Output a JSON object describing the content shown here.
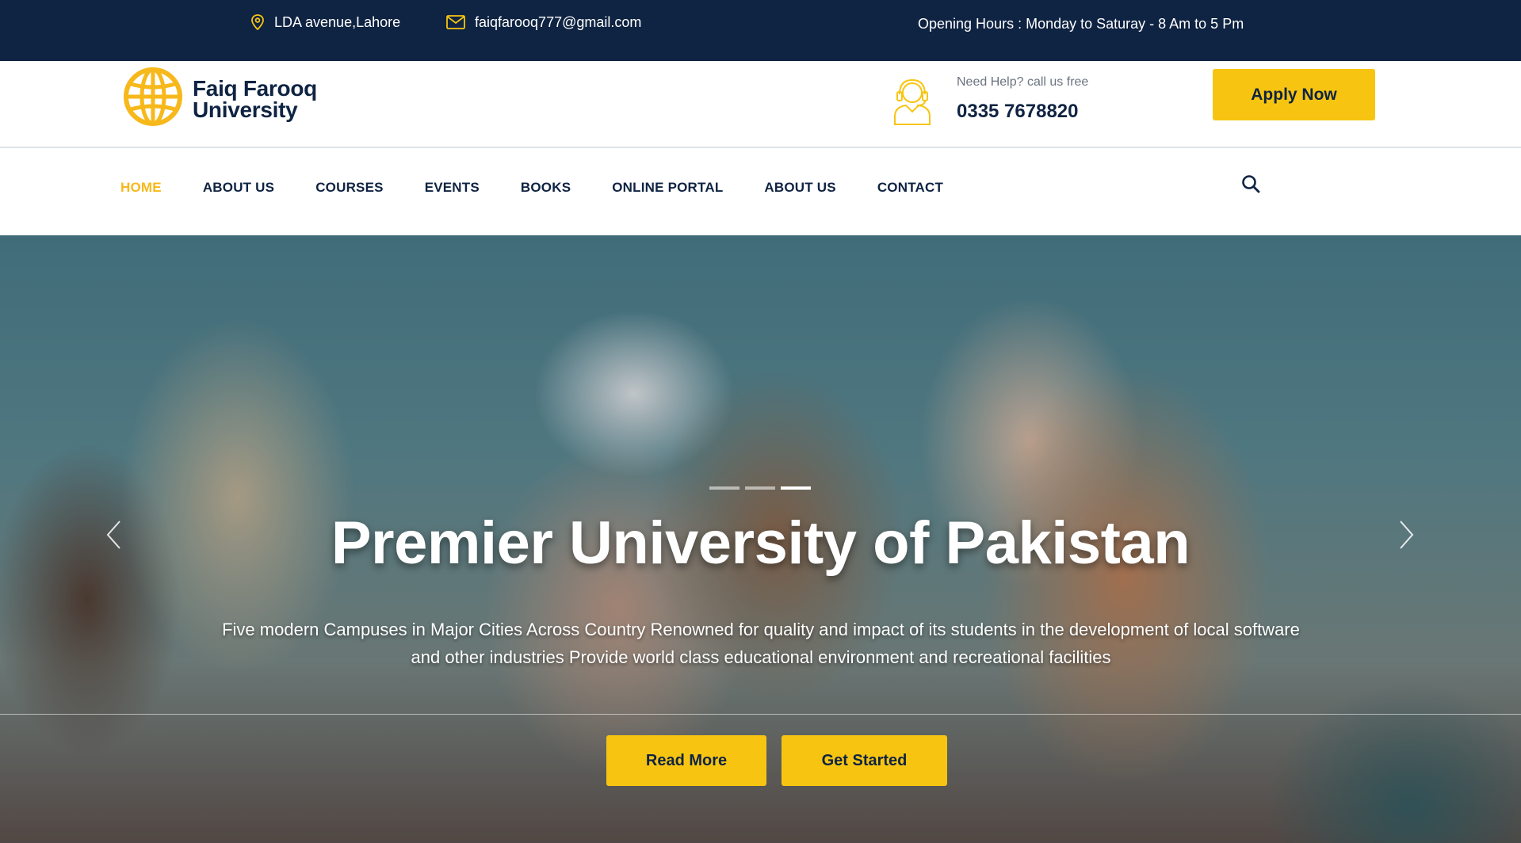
{
  "topbar": {
    "address": "LDA avenue,Lahore",
    "email": "faiqfarooq777@gmail.com",
    "hours": "Opening Hours : Monday to Saturay - 8 Am to 5 Pm"
  },
  "brand": {
    "name_line1": "Faiq Farooq",
    "name_line2": "University"
  },
  "help": {
    "label": "Need Help? call us free",
    "phone": "0335 7678820"
  },
  "header": {
    "apply_label": "Apply Now"
  },
  "nav": {
    "items": [
      {
        "label": "HOME",
        "active": true
      },
      {
        "label": "ABOUT US"
      },
      {
        "label": "COURSES"
      },
      {
        "label": "EVENTS"
      },
      {
        "label": "BOOKS"
      },
      {
        "label": "ONLINE PORTAL"
      },
      {
        "label": "ABOUT US"
      },
      {
        "label": "CONTACT"
      }
    ]
  },
  "hero": {
    "title": "Premier University of Pakistan",
    "description": "Five modern Campuses in Major Cities Across Country Renowned for quality and impact of its students in the development of local software and other industries Provide world class educational environment and recreational facilities",
    "read_more_label": "Read More",
    "get_started_label": "Get Started",
    "slides_total": 3,
    "active_slide": 3
  },
  "icons": {
    "address": "map-pin-icon",
    "email": "envelope-icon",
    "help": "headset-icon",
    "search": "search-icon",
    "prev": "chevron-left-icon",
    "next": "chevron-right-icon",
    "logo": "globe-icon"
  },
  "colors": {
    "navy": "#0f2342",
    "accent": "#f7c511",
    "nav_active": "#f7b81b"
  }
}
